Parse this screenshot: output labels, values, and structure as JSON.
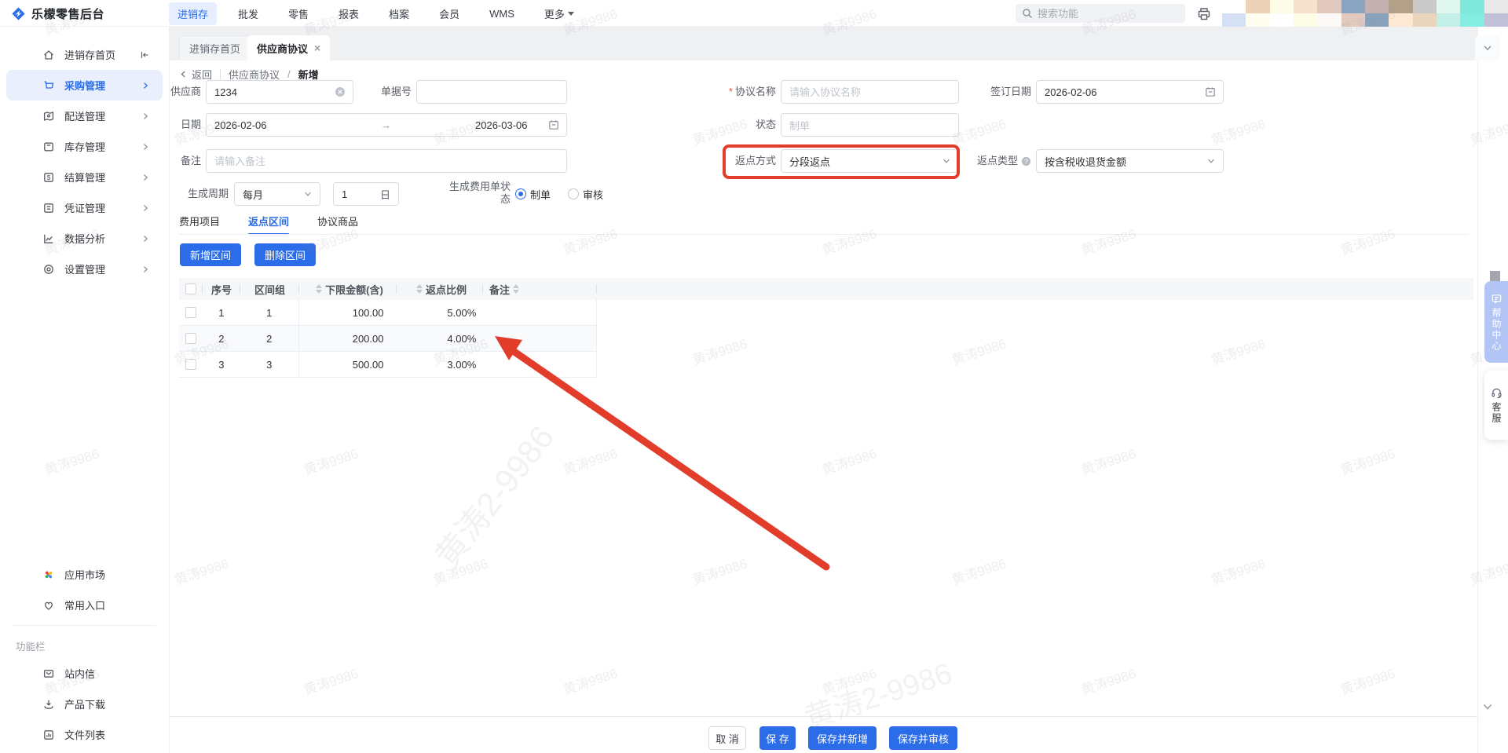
{
  "header": {
    "logo": "乐檬零售后台",
    "nav": [
      {
        "label": "进销存",
        "active": true
      },
      {
        "label": "批发"
      },
      {
        "label": "零售"
      },
      {
        "label": "报表"
      },
      {
        "label": "档案"
      },
      {
        "label": "会员"
      },
      {
        "label": "WMS"
      },
      {
        "label": "更多"
      }
    ],
    "search_placeholder": "搜索功能",
    "avatar_colors": [
      "#ffffff",
      "#ecd3b8",
      "#fdfce8",
      "#f7e3cd",
      "#e2c8bc",
      "#8ba4c2",
      "#c3b1b1",
      "#b2a089",
      "#c9c9c9",
      "#dff7ef",
      "#7fe9dc",
      "#e9e9e9",
      "#d6e0f5",
      "#fffdf0",
      "#ffffff",
      "#fdfde5",
      "#fdf8f8",
      "#e2cabf",
      "#8aa3bd",
      "#fde8d3",
      "#e8d5bc",
      "#c2f0e8",
      "#85ece0",
      "#c0c0d8"
    ]
  },
  "sidebar": {
    "items": [
      {
        "label": "进销存首页"
      },
      {
        "label": "采购管理",
        "active": true
      },
      {
        "label": "配送管理"
      },
      {
        "label": "库存管理"
      },
      {
        "label": "结算管理"
      },
      {
        "label": "凭证管理"
      },
      {
        "label": "数据分析"
      },
      {
        "label": "设置管理"
      }
    ],
    "shortcuts": [
      {
        "label": "应用市场"
      },
      {
        "label": "常用入口"
      }
    ],
    "section_label": "功能栏",
    "tools": [
      {
        "label": "站内信"
      },
      {
        "label": "产品下载"
      },
      {
        "label": "文件列表"
      }
    ]
  },
  "tabbar": {
    "tabs": [
      {
        "label": "进销存首页",
        "close": "×"
      },
      {
        "label": "供应商协议",
        "close": "×",
        "active": true
      }
    ]
  },
  "breadcrumb": {
    "back": "返回",
    "parent": "供应商协议",
    "separator": "/",
    "current": "新增"
  },
  "form": {
    "supplier": {
      "label": "供应商",
      "value": "1234"
    },
    "doc_no": {
      "label": "单据号",
      "value": ""
    },
    "date": {
      "label": "日期",
      "start": "2026-02-06",
      "arrow": "→",
      "end": "2026-03-06"
    },
    "remark": {
      "label": "备注",
      "placeholder": "请输入备注"
    },
    "agreement_name": {
      "label": "协议名称",
      "placeholder": "请输入协议名称"
    },
    "sign_date": {
      "label": "签订日期",
      "value": "2026-02-06"
    },
    "status": {
      "label": "状态",
      "value": "制单"
    },
    "rebate_method": {
      "label": "返点方式",
      "value": "分段返点"
    },
    "rebate_type": {
      "label": "返点类型",
      "value": "按含税收退货金额"
    },
    "gen_cycle": {
      "label": "生成周期",
      "value": "每月",
      "day_value": "1",
      "day_unit": "日"
    },
    "gen_fee_status": {
      "label_line1": "生成费用单状",
      "label_line2": "态",
      "options": [
        {
          "label": "制单",
          "selected": true
        },
        {
          "label": "审核",
          "selected": false
        }
      ]
    }
  },
  "content_tabs": [
    {
      "label": "费用项目"
    },
    {
      "label": "返点区间",
      "active": true
    },
    {
      "label": "协议商品"
    }
  ],
  "toolbar": {
    "add": "新增区间",
    "remove": "删除区间"
  },
  "table": {
    "columns": {
      "seq": "序号",
      "group": "区间组",
      "lower": "下限金额(含)",
      "rate": "返点比例",
      "note": "备注"
    },
    "rows": [
      {
        "seq": "1",
        "group": "1",
        "lower": "100.00",
        "rate": "5.00%",
        "note": ""
      },
      {
        "seq": "2",
        "group": "2",
        "lower": "200.00",
        "rate": "4.00%",
        "note": ""
      },
      {
        "seq": "3",
        "group": "3",
        "lower": "500.00",
        "rate": "3.00%",
        "note": ""
      }
    ]
  },
  "footer": {
    "cancel": "取 消",
    "save": "保 存",
    "save_new": "保存并新增",
    "save_audit": "保存并审核"
  },
  "widgets": {
    "help": "帮助中心",
    "service": "客服"
  },
  "watermark": {
    "small": "黄涛9986",
    "large": "黄涛2-9986"
  },
  "colors": {
    "primary": "#2b6de8",
    "annotation": "#e23c2b"
  }
}
